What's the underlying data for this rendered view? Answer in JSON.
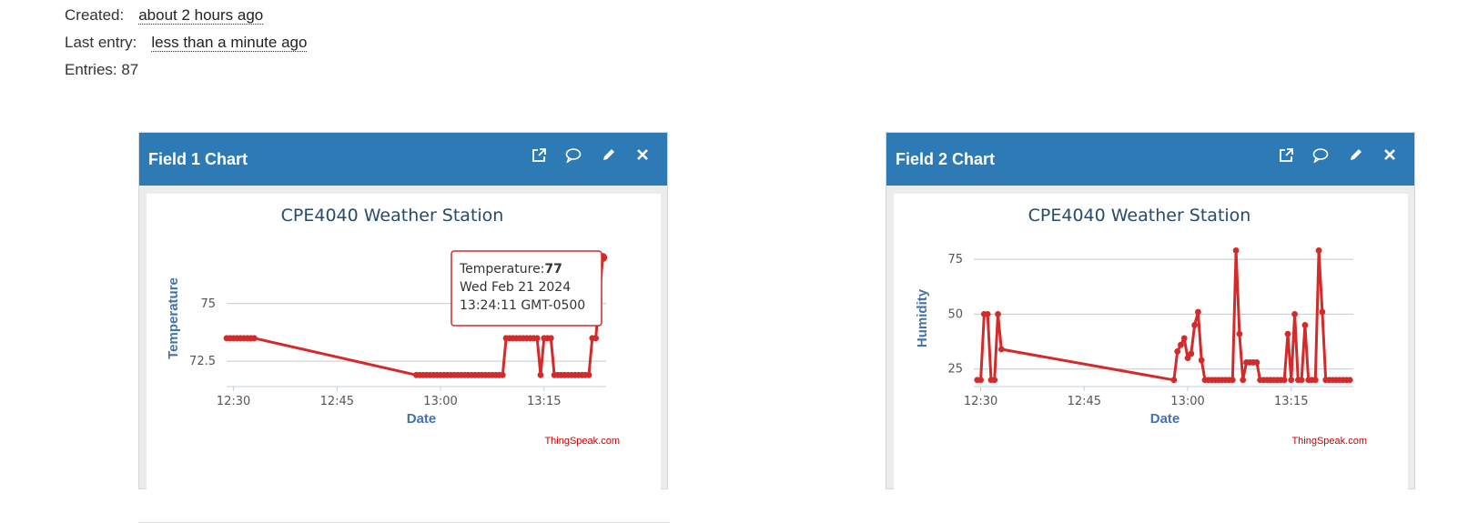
{
  "meta": {
    "created_label": "Created:",
    "created_value": "about 2 hours ago",
    "last_entry_label": "Last entry:",
    "last_entry_value": "less than a minute ago",
    "entries_text": "Entries: 87"
  },
  "icons": [
    "external-link-icon",
    "comment-icon",
    "pencil-icon",
    "close-icon"
  ],
  "colors": {
    "header": "#2e7ab4",
    "series": "#d42a2a",
    "title": "#274b6d",
    "axis_title": "#4572a7",
    "credit": "#cc0000"
  },
  "panels": [
    {
      "title": "Field 1 Chart",
      "credit": "ThingSpeak.com",
      "tooltip": {
        "line1_label": "Temperature:",
        "line1_value": "77",
        "line2": "Wed Feb 21 2024",
        "line3": "13:24:11 GMT-0500"
      }
    },
    {
      "title": "Field 2 Chart",
      "credit": "ThingSpeak.com"
    }
  ],
  "chart_data": [
    {
      "type": "line",
      "title": "CPE4040 Weather Station",
      "xlabel": "Date",
      "ylabel": "Temperature",
      "x_ticks": [
        "12:30",
        "12:45",
        "13:00",
        "13:15"
      ],
      "y_ticks": [
        "72.5",
        "75"
      ],
      "xlim": [
        "12:29",
        "13:24"
      ],
      "ylim": [
        71.4,
        77.4
      ],
      "grid": true,
      "legend": "none",
      "series": [
        {
          "x": [
            "12:29",
            "12:29.5",
            "12:30",
            "12:30.5",
            "12:31",
            "12:31.5",
            "12:32",
            "12:32.5",
            "12:33",
            "12:56.5",
            "12:57",
            "12:57.5",
            "12:58",
            "12:58.5",
            "12:59",
            "12:59.5",
            "13:00",
            "13:00.5",
            "13:01",
            "13:01.5",
            "13:02",
            "13:02.5",
            "13:03",
            "13:03.5",
            "13:04",
            "13:04.5",
            "13:05",
            "13:05.5",
            "13:06",
            "13:06.5",
            "13:07",
            "13:07.5",
            "13:08",
            "13:08.5",
            "13:09",
            "13:09.5",
            "13:10",
            "13:10.5",
            "13:11",
            "13:11.5",
            "13:12",
            "13:12.5",
            "13:13",
            "13:13.5",
            "13:14",
            "13:14.5",
            "13:15",
            "13:15.5",
            "13:16",
            "13:16.5",
            "13:17",
            "13:17.5",
            "13:18",
            "13:18.5",
            "13:19",
            "13:19.5",
            "13:20",
            "13:20.5",
            "13:21",
            "13:21.5",
            "13:22",
            "13:22.5",
            "13:23",
            "13:23.5"
          ],
          "values": [
            73.5,
            73.5,
            73.5,
            73.5,
            73.5,
            73.5,
            73.5,
            73.5,
            73.5,
            71.9,
            71.9,
            71.9,
            71.9,
            71.9,
            71.9,
            71.9,
            71.9,
            71.9,
            71.9,
            71.9,
            71.9,
            71.9,
            71.9,
            71.9,
            71.9,
            71.9,
            71.9,
            71.9,
            71.9,
            71.9,
            71.9,
            71.9,
            71.9,
            71.9,
            71.9,
            73.5,
            73.5,
            73.5,
            73.5,
            73.5,
            73.5,
            73.5,
            73.5,
            73.5,
            73.5,
            71.9,
            73.5,
            73.5,
            73.5,
            71.9,
            71.9,
            71.9,
            71.9,
            71.9,
            71.9,
            71.9,
            71.9,
            71.9,
            71.9,
            71.9,
            73.5,
            73.5,
            75.2,
            77.0
          ]
        }
      ]
    },
    {
      "type": "line",
      "title": "CPE4040 Weather Station",
      "xlabel": "Date",
      "ylabel": "Humidity",
      "x_ticks": [
        "12:30",
        "12:45",
        "13:00",
        "13:15"
      ],
      "y_ticks": [
        "25",
        "50",
        "75"
      ],
      "xlim": [
        "12:29",
        "13:24"
      ],
      "ylim": [
        17,
        80
      ],
      "grid": true,
      "legend": "none",
      "series": [
        {
          "x": [
            "12:29.5",
            "12:30",
            "12:30.5",
            "12:31",
            "12:31.5",
            "12:32",
            "12:32.5",
            "12:33",
            "12:58",
            "12:58.5",
            "12:59",
            "12:59.5",
            "13:00",
            "13:00.5",
            "13:01",
            "13:01.5",
            "13:02",
            "13:02.5",
            "13:03",
            "13:03.5",
            "13:04",
            "13:04.5",
            "13:05",
            "13:05.5",
            "13:06",
            "13:06.5",
            "13:07",
            "13:07.5",
            "13:08",
            "13:08.5",
            "13:09",
            "13:09.5",
            "13:10",
            "13:10.5",
            "13:11",
            "13:11.5",
            "13:12",
            "13:12.5",
            "13:13",
            "13:13.5",
            "13:14",
            "13:14.5",
            "13:15",
            "13:15.5",
            "13:16",
            "13:16.5",
            "13:17",
            "13:17.5",
            "13:18",
            "13:18.5",
            "13:19",
            "13:19.5",
            "13:20",
            "13:20.5",
            "13:21",
            "13:21.5",
            "13:22",
            "13:22.5",
            "13:23",
            "13:23.5"
          ],
          "values": [
            20,
            20,
            50,
            50,
            20,
            20,
            50,
            34,
            20,
            33,
            36,
            39,
            30,
            32,
            45,
            51,
            29,
            20,
            20,
            20,
            20,
            20,
            20,
            20,
            20,
            20,
            79,
            41,
            20,
            28,
            28,
            28,
            28,
            20,
            20,
            20,
            20,
            20,
            20,
            20,
            20,
            41,
            20,
            50,
            20,
            20,
            45,
            20,
            20,
            20,
            79,
            51,
            20,
            20,
            20,
            20,
            20,
            20,
            20,
            20
          ]
        }
      ]
    }
  ]
}
